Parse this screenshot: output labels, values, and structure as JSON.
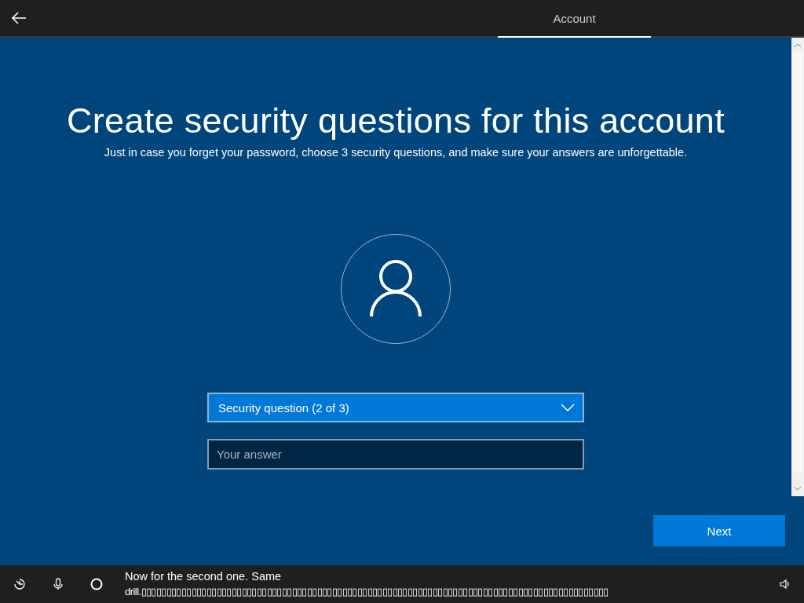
{
  "top_bar": {
    "tabs": [
      {
        "label": "Account",
        "selected": true
      }
    ]
  },
  "heading": "Create security questions for this account",
  "subtitle": "Just in case you forget your password, choose 3 security questions, and make sure your answers are unforgettable.",
  "security_question": {
    "value": "Security question (2 of 3)"
  },
  "answer": {
    "placeholder": "Your answer"
  },
  "next_button": "Next",
  "caption_lines": [
    "Now for the second one. Same",
    "drill.▯▯▯▯▯▯▯▯▯▯▯▯▯▯▯▯▯▯▯▯▯▯▯▯▯▯▯▯▯▯▯▯▯▯▯▯▯▯▯▯▯▯▯▯▯▯▯▯▯▯▯▯▯▯▯▯▯▯▯▯▯▯▯▯▯▯▯▯▯▯▯▯▯▯▯▯▯▯▯▯▯▯▯▯▯▯▯▯▯▯▯▯▯"
  ]
}
